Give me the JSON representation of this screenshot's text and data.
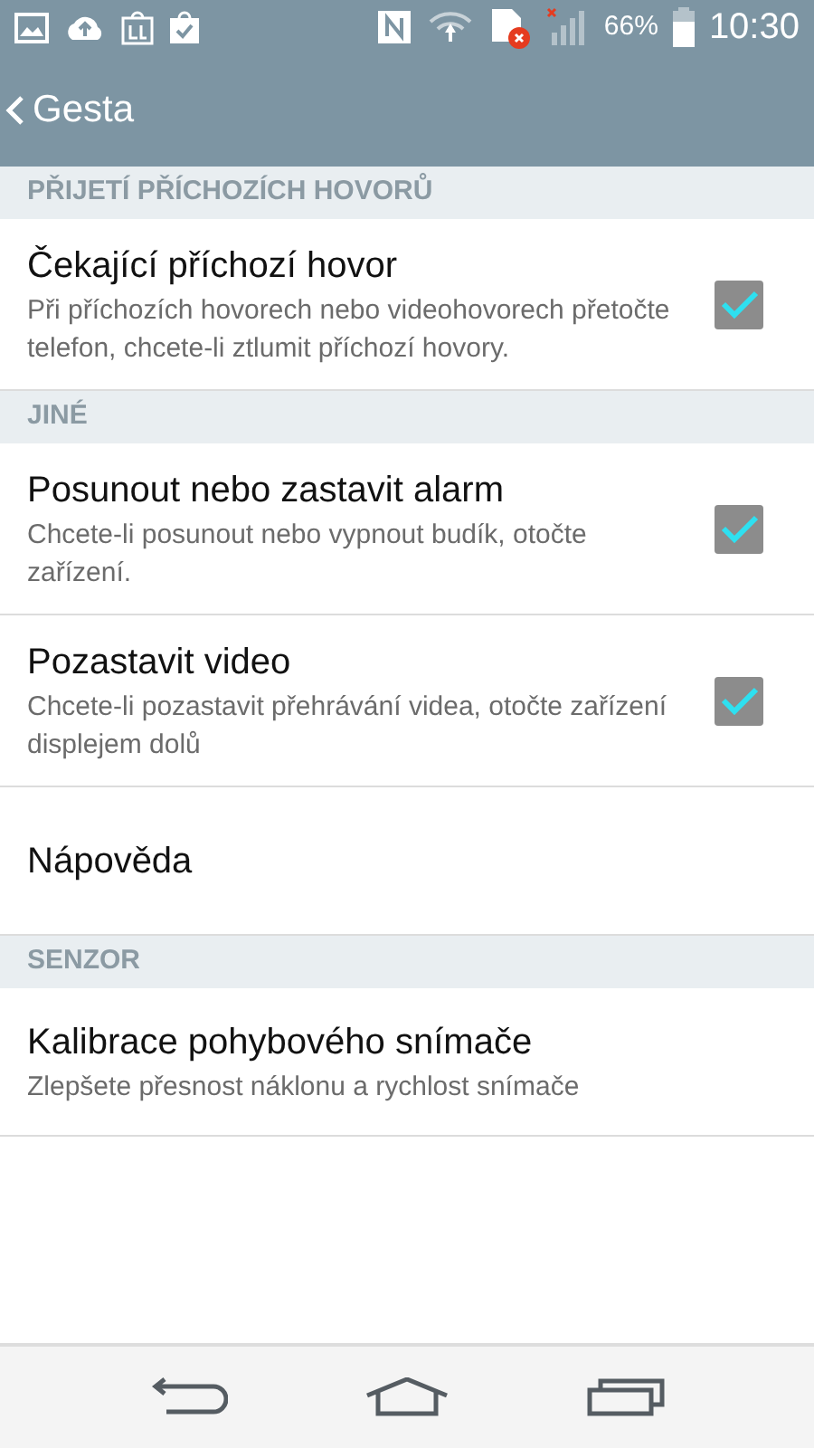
{
  "status_bar": {
    "battery": "66%",
    "time": "10:30"
  },
  "header": {
    "back_label": "Gesta"
  },
  "sections": [
    {
      "title": "PŘIJETÍ PŘÍCHOZÍCH HOVORŮ",
      "items": [
        {
          "kind": "checkbox",
          "title": "Čekající příchozí hovor",
          "summary": "Při příchozích hovorech nebo videohovorech přetočte telefon, chcete-li ztlumit příchozí hovory.",
          "checked": true
        }
      ]
    },
    {
      "title": "JINÉ",
      "items": [
        {
          "kind": "checkbox",
          "title": "Posunout nebo zastavit alarm",
          "summary": "Chcete-li posunout nebo vypnout budík, otočte zařízení.",
          "checked": true
        },
        {
          "kind": "checkbox",
          "title": "Pozastavit video",
          "summary": "Chcete-li pozastavit přehrávání videa, otočte zařízení displejem dolů",
          "checked": true
        },
        {
          "kind": "plain",
          "title": "Nápověda"
        }
      ]
    },
    {
      "title": "SENZOR",
      "items": [
        {
          "kind": "plain",
          "title": "Kalibrace pohybového snímače",
          "summary": "Zlepšete přesnost náklonu a rychlost snímače"
        }
      ]
    }
  ]
}
